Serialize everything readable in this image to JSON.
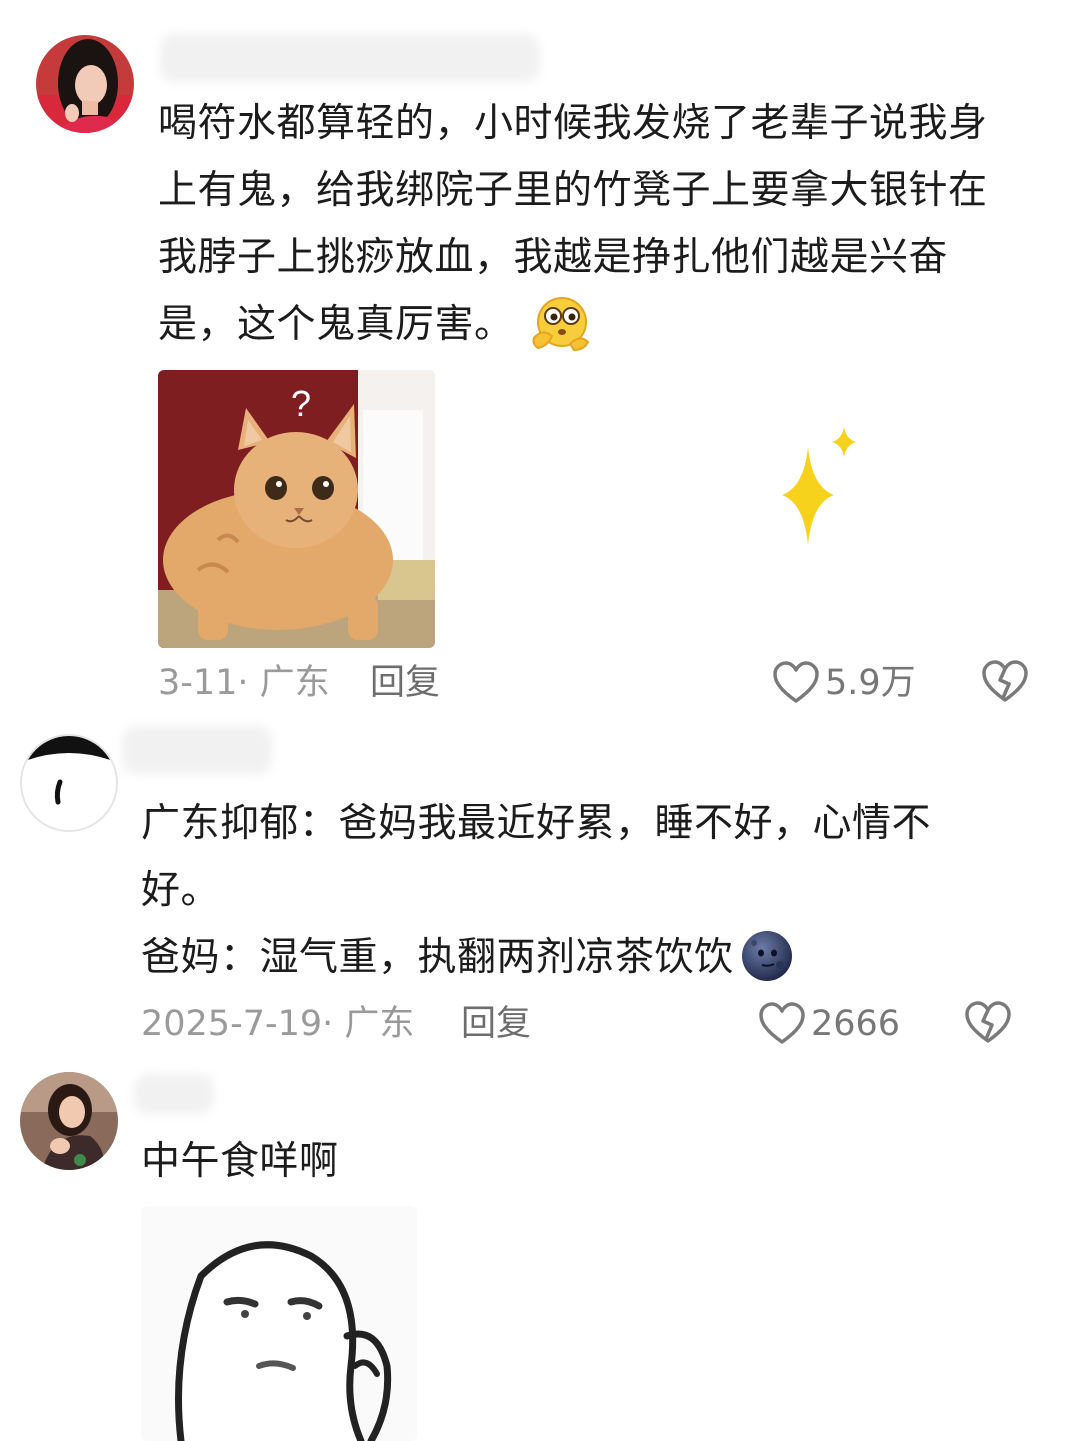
{
  "comments": [
    {
      "text_lines": [
        "喝符水都算轻的，小时候我发烧了老辈子说我身",
        "上有鬼，给我绑院子里的竹凳子上要拿大银针在",
        "我脖子上挑痧放血，我越是挣扎他们越是兴奋",
        "是，这个鬼真厉害。"
      ],
      "emoji": "thinking-face-emoji",
      "image_caption": "?",
      "date_location": "3-11· 广东",
      "reply_label": "回复",
      "likes": "5.9万"
    },
    {
      "text_lines": [
        "广东抑郁：爸妈我最近好累，睡不好，心情不",
        "好。",
        "爸妈：湿气重，执翻两剂凉茶饮饮"
      ],
      "emoji": "new-moon-face-emoji",
      "date_location": "2025-7-19· 广东",
      "reply_label": "回复",
      "likes": "2666"
    },
    {
      "text_lines": [
        "中午食咩啊"
      ]
    }
  ],
  "colors": {
    "text": "#1c1c1c",
    "meta": "#9a9a9a",
    "sparkle": "#f7d21c"
  }
}
